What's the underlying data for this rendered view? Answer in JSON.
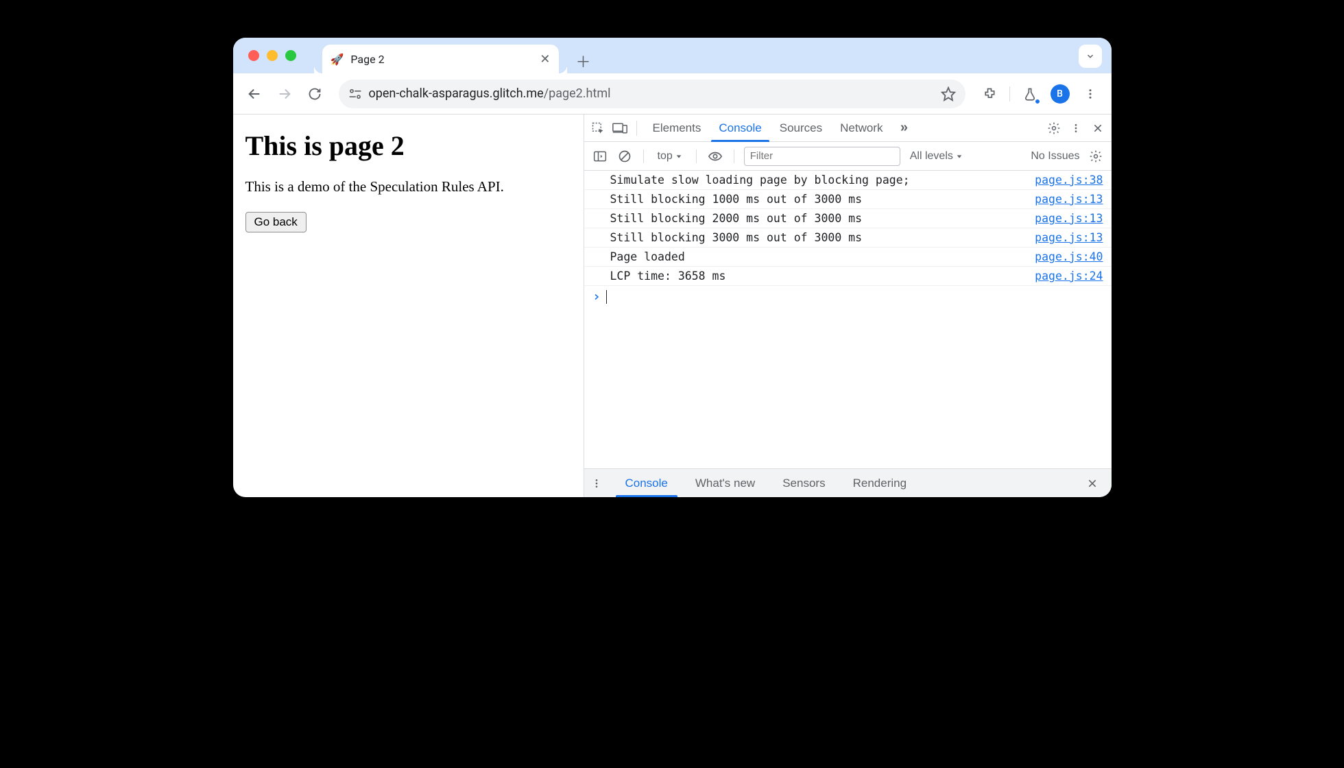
{
  "window": {
    "traffic": [
      "close",
      "minimize",
      "zoom"
    ]
  },
  "tab": {
    "favicon": "🚀",
    "title": "Page 2"
  },
  "toolbar": {
    "url_host": "open-chalk-asparagus.glitch.me",
    "url_path": "/page2.html",
    "avatar_letter": "B"
  },
  "page": {
    "heading": "This is page 2",
    "paragraph": "This is a demo of the Speculation Rules API.",
    "button_label": "Go back"
  },
  "devtools": {
    "tabs": [
      "Elements",
      "Console",
      "Sources",
      "Network"
    ],
    "active_tab": "Console",
    "more_tabs_icon": "»"
  },
  "console_toolbar": {
    "context": "top",
    "filter_placeholder": "Filter",
    "levels_label": "All levels",
    "issues_label": "No Issues"
  },
  "console": {
    "entries": [
      {
        "msg": "Simulate slow loading page by blocking page;",
        "src": "page.js:38"
      },
      {
        "msg": "Still blocking 1000 ms out of 3000 ms",
        "src": "page.js:13"
      },
      {
        "msg": "Still blocking 2000 ms out of 3000 ms",
        "src": "page.js:13"
      },
      {
        "msg": "Still blocking 3000 ms out of 3000 ms",
        "src": "page.js:13"
      },
      {
        "msg": "Page loaded",
        "src": "page.js:40"
      },
      {
        "msg": "LCP time: 3658 ms",
        "src": "page.js:24"
      }
    ]
  },
  "drawer": {
    "tabs": [
      "Console",
      "What's new",
      "Sensors",
      "Rendering"
    ],
    "active": "Console"
  }
}
